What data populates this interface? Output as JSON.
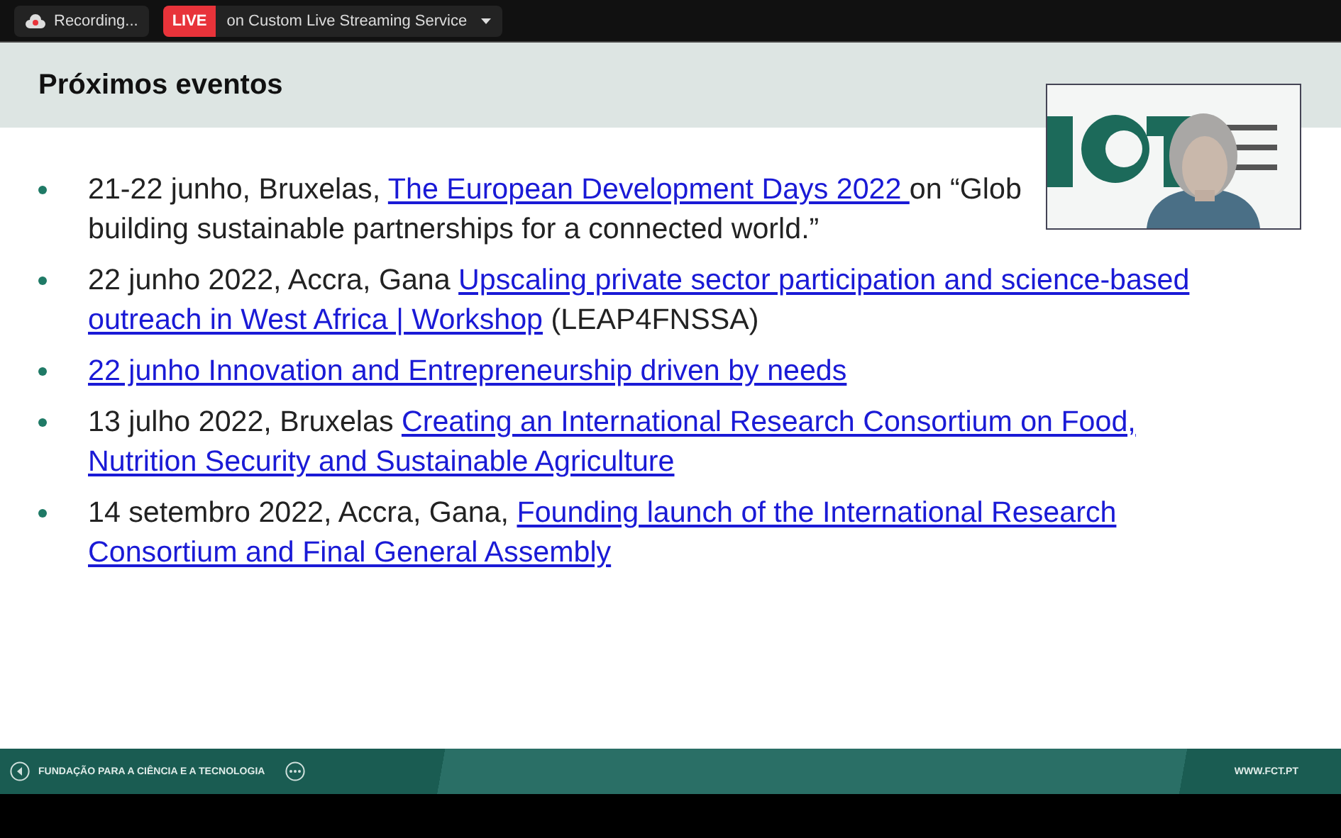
{
  "top_bar": {
    "recording": "Recording...",
    "live_badge": "LIVE",
    "stream_target": "on Custom Live Streaming Service"
  },
  "slide": {
    "title": "Próximos eventos",
    "items": [
      {
        "lines": [
          [
            {
              "text": "21-22 junho, Bruxelas, ",
              "link": false
            },
            {
              "text": "The European Development Days 2022 ",
              "link": true
            },
            {
              "text": "on “Glob",
              "link": false
            }
          ],
          [
            {
              "text": "building sustainable partnerships for a connected world.”",
              "link": false
            }
          ]
        ]
      },
      {
        "lines": [
          [
            {
              "text": "22 junho 2022, Accra, Gana ",
              "link": false
            },
            {
              "text": "Upscaling private sector participation and science-based",
              "link": true
            }
          ],
          [
            {
              "text": "outreach in West Africa | Workshop",
              "link": true
            },
            {
              "text": " (LEAP4FNSSA)",
              "link": false
            }
          ]
        ]
      },
      {
        "lines": [
          [
            {
              "text": "22 junho Innovation and Entrepreneurship driven by needs",
              "link": true
            }
          ]
        ]
      },
      {
        "lines": [
          [
            {
              "text": "13 julho 2022, Bruxelas ",
              "link": false
            },
            {
              "text": "Creating an International Research Consortium on Food,",
              "link": true
            }
          ],
          [
            {
              "text": "Nutrition Security and Sustainable Agriculture",
              "link": true
            }
          ]
        ]
      },
      {
        "lines": [
          [
            {
              "text": "14 setembro 2022, Accra, Gana, ",
              "link": false
            },
            {
              "text": "Founding launch of the International Research",
              "link": true
            }
          ],
          [
            {
              "text": "Consortium and Final General Assembly",
              "link": true
            }
          ]
        ]
      }
    ],
    "footer_left": "FUNDAÇÃO PARA A CIÊNCIA E A TECNOLOGIA",
    "footer_right": "WWW.FCT.PT"
  }
}
